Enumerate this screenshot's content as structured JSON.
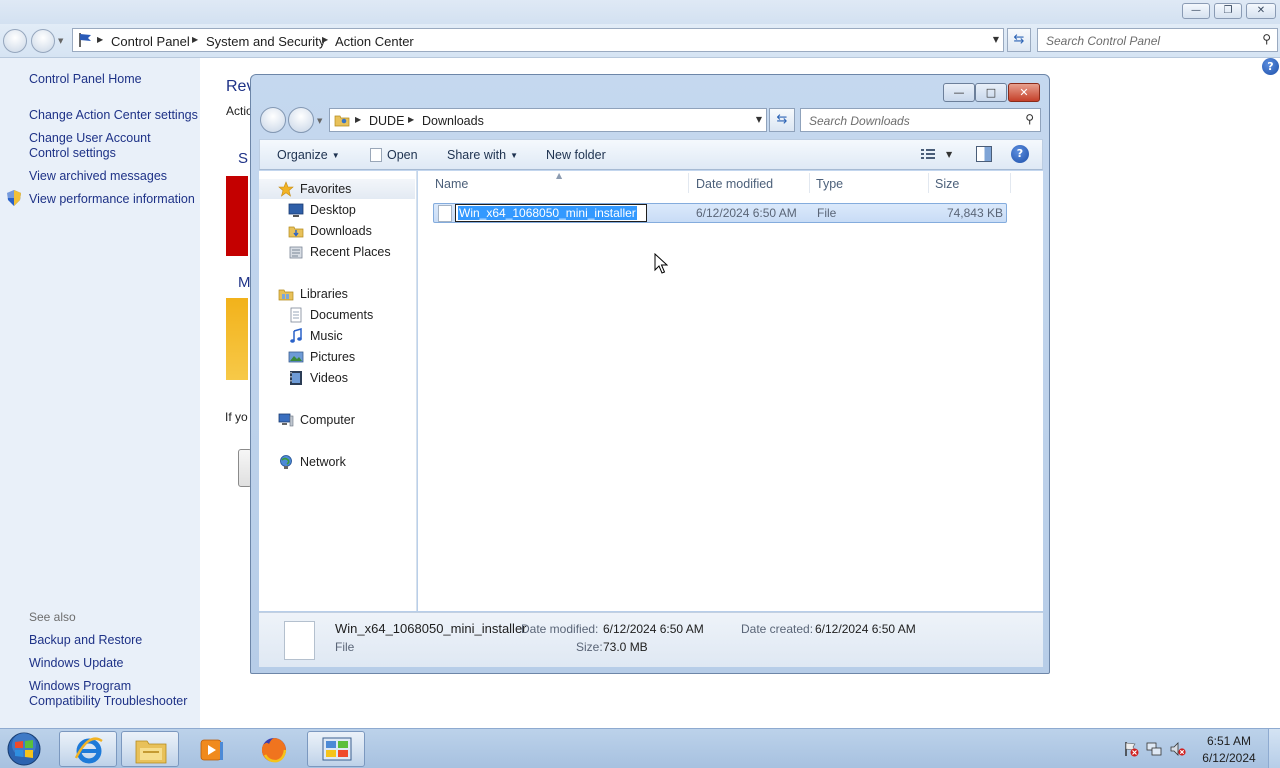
{
  "control_panel": {
    "breadcrumb": [
      "Control Panel",
      "System and Security",
      "Action Center"
    ],
    "search_placeholder": "Search Control Panel",
    "sidebar": {
      "home": "Control Panel Home",
      "links": [
        "Change Action Center settings",
        "Change User Account Control settings",
        "View archived messages",
        "View performance information"
      ],
      "see_also_label": "See also",
      "see_also": [
        "Backup and Restore",
        "Windows Update",
        "Windows Program Compatibility Troubleshooter"
      ]
    },
    "main_fragments": [
      "Rev",
      "Actio",
      "S",
      "M",
      "If yo"
    ],
    "colors": {
      "security_bar": "#c40000",
      "maintenance_bar": "#f2b21b",
      "link": "#1e3287"
    }
  },
  "explorer": {
    "breadcrumb": [
      "DUDE",
      "Downloads"
    ],
    "search_placeholder": "Search Downloads",
    "toolbar": {
      "organize": "Organize",
      "open": "Open",
      "share_with": "Share with",
      "new_folder": "New folder"
    },
    "nav": {
      "favorites": "Favorites",
      "favorites_items": [
        "Desktop",
        "Downloads",
        "Recent Places"
      ],
      "libraries": "Libraries",
      "libraries_items": [
        "Documents",
        "Music",
        "Pictures",
        "Videos"
      ],
      "computer": "Computer",
      "network": "Network"
    },
    "columns": {
      "name": "Name",
      "date_modified": "Date modified",
      "type": "Type",
      "size": "Size"
    },
    "file": {
      "name": "Win_x64_1068050_mini_installer",
      "date_modified": "6/12/2024 6:50 AM",
      "type": "File",
      "size": "74,843 KB"
    },
    "details": {
      "name": "Win_x64_1068050_mini_installer",
      "type": "File",
      "date_modified_label": "Date modified:",
      "date_modified": "6/12/2024 6:50 AM",
      "size_label": "Size:",
      "size": "73.0 MB",
      "date_created_label": "Date created:",
      "date_created": "6/12/2024 6:50 AM"
    },
    "selection_color": "#3399ff"
  },
  "taskbar": {
    "apps": [
      "internet-explorer-icon",
      "windows-explorer-icon",
      "media-player-icon",
      "firefox-icon",
      "control-panel-icon"
    ],
    "clock_time": "6:51 AM",
    "clock_date": "6/12/2024"
  }
}
